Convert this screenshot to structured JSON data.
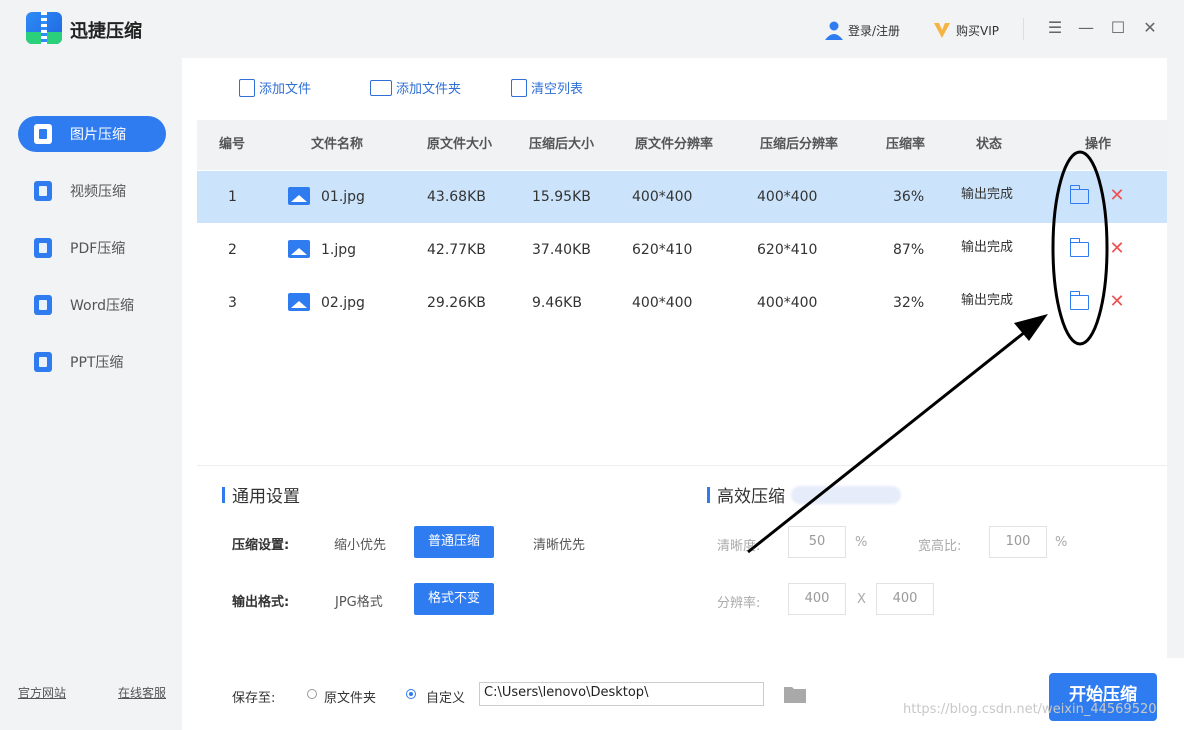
{
  "app": {
    "title": "迅捷压缩"
  },
  "header": {
    "login_label": "登录/注册",
    "vip_label": "购买VIP"
  },
  "sidebar": {
    "items": [
      {
        "label": "图片压缩",
        "icon": "image-compress-icon",
        "active": true
      },
      {
        "label": "视频压缩",
        "icon": "video-compress-icon",
        "active": false
      },
      {
        "label": "PDF压缩",
        "icon": "pdf-compress-icon",
        "active": false
      },
      {
        "label": "Word压缩",
        "icon": "word-compress-icon",
        "active": false
      },
      {
        "label": "PPT压缩",
        "icon": "ppt-compress-icon",
        "active": false
      }
    ],
    "website_label": "官方网站",
    "support_label": "在线客服"
  },
  "toolbar": {
    "add_file": "添加文件",
    "add_folder": "添加文件夹",
    "clear_list": "清空列表"
  },
  "table": {
    "headers": {
      "no": "编号",
      "name": "文件名称",
      "orig_size": "原文件大小",
      "comp_size": "压缩后大小",
      "orig_res": "原文件分辨率",
      "comp_res": "压缩后分辨率",
      "ratio": "压缩率",
      "status": "状态",
      "action": "操作"
    },
    "rows": [
      {
        "no": "1",
        "name": "01.jpg",
        "orig_size": "43.68KB",
        "comp_size": "15.95KB",
        "orig_res": "400*400",
        "comp_res": "400*400",
        "ratio": "36%",
        "status": "输出完成",
        "selected": true
      },
      {
        "no": "2",
        "name": "1.jpg",
        "orig_size": "42.77KB",
        "comp_size": "37.40KB",
        "orig_res": "620*410",
        "comp_res": "620*410",
        "ratio": "87%",
        "status": "输出完成",
        "selected": false
      },
      {
        "no": "3",
        "name": "02.jpg",
        "orig_size": "29.26KB",
        "comp_size": "9.46KB",
        "orig_res": "400*400",
        "comp_res": "400*400",
        "ratio": "32%",
        "status": "输出完成",
        "selected": false
      }
    ]
  },
  "general": {
    "title": "通用设置",
    "compress_label": "压缩设置:",
    "compress_options": [
      "缩小优先",
      "普通压缩",
      "清晰优先"
    ],
    "compress_selected": "普通压缩",
    "format_label": "输出格式:",
    "format_options": [
      "JPG格式",
      "格式不变"
    ],
    "format_selected": "格式不变"
  },
  "advanced": {
    "title": "高效压缩",
    "clarity_label": "清晰度:",
    "clarity_value": "50",
    "clarity_unit": "%",
    "aspect_label": "宽高比:",
    "aspect_value": "100",
    "aspect_unit": "%",
    "resolution_label": "分辨率:",
    "res_w": "400",
    "res_x": "X",
    "res_h": "400"
  },
  "save": {
    "label": "保存至:",
    "opt_original": "原文件夹",
    "opt_custom": "自定义",
    "selected": "自定义",
    "path": "C:\\Users\\lenovo\\Desktop\\"
  },
  "start_label": "开始压缩",
  "watermark": "https://blog.csdn.net/weixin_44569520",
  "colors": {
    "accent": "#2f7cf0",
    "selected_row": "#cce4fb",
    "delete": "#f05050",
    "annotation": "#000000"
  }
}
